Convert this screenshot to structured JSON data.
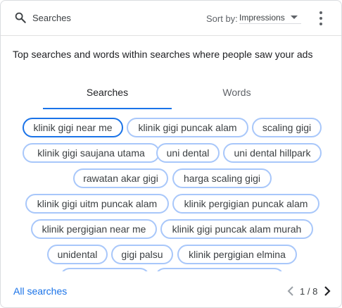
{
  "header": {
    "search_label": "Searches",
    "sort_by_label": "Sort by:",
    "sort_value": "Impressions",
    "icons": {
      "search": "search-icon",
      "sort": "chevron-down-icon",
      "more": "more-vert-icon"
    }
  },
  "description": "Top searches and words within searches where people saw your ads",
  "tabs": [
    {
      "label": "Searches",
      "active": true
    },
    {
      "label": "Words",
      "active": false
    }
  ],
  "chips": [
    {
      "label": "klinik gigi near me",
      "selected": true
    },
    {
      "label": "klinik gigi puncak alam",
      "selected": false
    },
    {
      "label": "scaling gigi",
      "selected": false
    },
    {
      "label": "klinik gigi saujana utama",
      "selected": false
    },
    {
      "label": "uni dental",
      "selected": false
    },
    {
      "label": "uni dental hillpark",
      "selected": false
    },
    {
      "label": "rawatan akar gigi",
      "selected": false
    },
    {
      "label": "harga scaling gigi",
      "selected": false
    },
    {
      "label": "klinik gigi uitm puncak alam",
      "selected": false
    },
    {
      "label": "klinik pergigian puncak alam",
      "selected": false
    },
    {
      "label": "klinik pergigian near me",
      "selected": false
    },
    {
      "label": "klinik gigi puncak alam murah",
      "selected": false
    },
    {
      "label": "unidental",
      "selected": false
    },
    {
      "label": "gigi palsu",
      "selected": false
    },
    {
      "label": "klinik pergigian elmina",
      "selected": false
    }
  ],
  "footer": {
    "all_searches_label": "All searches",
    "page_indicator": "1 / 8",
    "icons": {
      "prev": "chevron-left-icon",
      "next": "chevron-right-icon"
    }
  },
  "colors": {
    "accent": "#1a73e8",
    "chip_border": "#a8c7fa",
    "text": "#202124",
    "muted": "#5f6368"
  }
}
